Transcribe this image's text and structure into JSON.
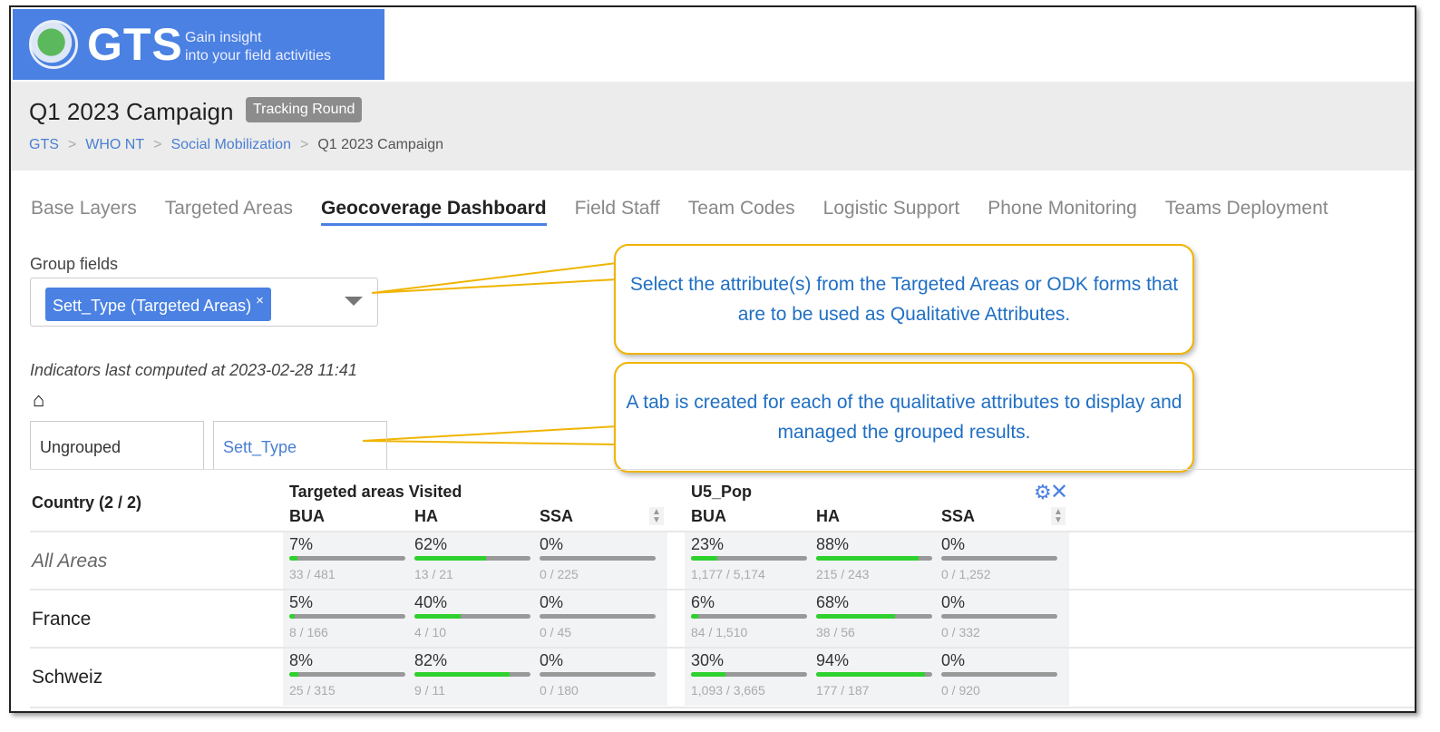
{
  "header": {
    "logo_text": "GTS",
    "tagline_1": "Gain insight",
    "tagline_2": "into your field activities"
  },
  "page": {
    "title": "Q1 2023 Campaign",
    "badge": "Tracking Round",
    "breadcrumbs": [
      {
        "label": "GTS"
      },
      {
        "label": "WHO NT"
      },
      {
        "label": "Social Mobilization"
      },
      {
        "label": "Q1 2023 Campaign"
      }
    ]
  },
  "tabs": [
    {
      "label": "Base Layers"
    },
    {
      "label": "Targeted Areas"
    },
    {
      "label": "Geocoverage Dashboard",
      "active": true
    },
    {
      "label": "Field Staff"
    },
    {
      "label": "Team Codes"
    },
    {
      "label": "Logistic Support"
    },
    {
      "label": "Phone Monitoring"
    },
    {
      "label": "Teams Deployment"
    }
  ],
  "group_fields": {
    "label": "Group fields",
    "chip": "Sett_Type (Targeted Areas)",
    "chip_remove": "×"
  },
  "callouts": [
    "Select the attribute(s) from the Targeted Areas or ODK forms that are to be used as Qualitative Attributes.",
    "A tab is created for each of the qualitative attributes to display and managed the grouped results."
  ],
  "computed_text": "Indicators last computed at 2023-02-28 11:41",
  "group_tabs": [
    {
      "label": "Ungrouped"
    },
    {
      "label": "Sett_Type",
      "active": true
    }
  ],
  "table": {
    "country_header": "Country (2 / 2)",
    "groups": [
      {
        "title": "Targeted areas Visited",
        "cols": [
          "BUA",
          "HA",
          "SSA"
        ]
      },
      {
        "title": "U5_Pop",
        "cols": [
          "BUA",
          "HA",
          "SSA"
        ]
      }
    ],
    "rows": [
      {
        "name": "All Areas",
        "italic": true,
        "cells": [
          [
            "7%",
            "33 / 481",
            7
          ],
          [
            "62%",
            "13 / 21",
            62
          ],
          [
            "0%",
            "0 / 225",
            0
          ],
          [
            "23%",
            "1,177 / 5,174",
            23
          ],
          [
            "88%",
            "215 / 243",
            88
          ],
          [
            "0%",
            "0 / 1,252",
            0
          ]
        ]
      },
      {
        "name": "France",
        "cells": [
          [
            "5%",
            "8 / 166",
            5
          ],
          [
            "40%",
            "4 / 10",
            40
          ],
          [
            "0%",
            "0 / 45",
            0
          ],
          [
            "6%",
            "84 / 1,510",
            6
          ],
          [
            "68%",
            "38 / 56",
            68
          ],
          [
            "0%",
            "0 / 332",
            0
          ]
        ]
      },
      {
        "name": "Schweiz",
        "cells": [
          [
            "8%",
            "25 / 315",
            8
          ],
          [
            "82%",
            "9 / 11",
            82
          ],
          [
            "0%",
            "0 / 180",
            0
          ],
          [
            "30%",
            "1,093 / 3,665",
            30
          ],
          [
            "94%",
            "177 / 187",
            94
          ],
          [
            "0%",
            "0 / 920",
            0
          ]
        ]
      }
    ]
  },
  "colors": {
    "brand": "#4a81e2",
    "bar_fill": "#2ed12e",
    "bar_track": "#999999",
    "callout_border": "#f0b400",
    "callout_text": "#1f6fc4"
  }
}
